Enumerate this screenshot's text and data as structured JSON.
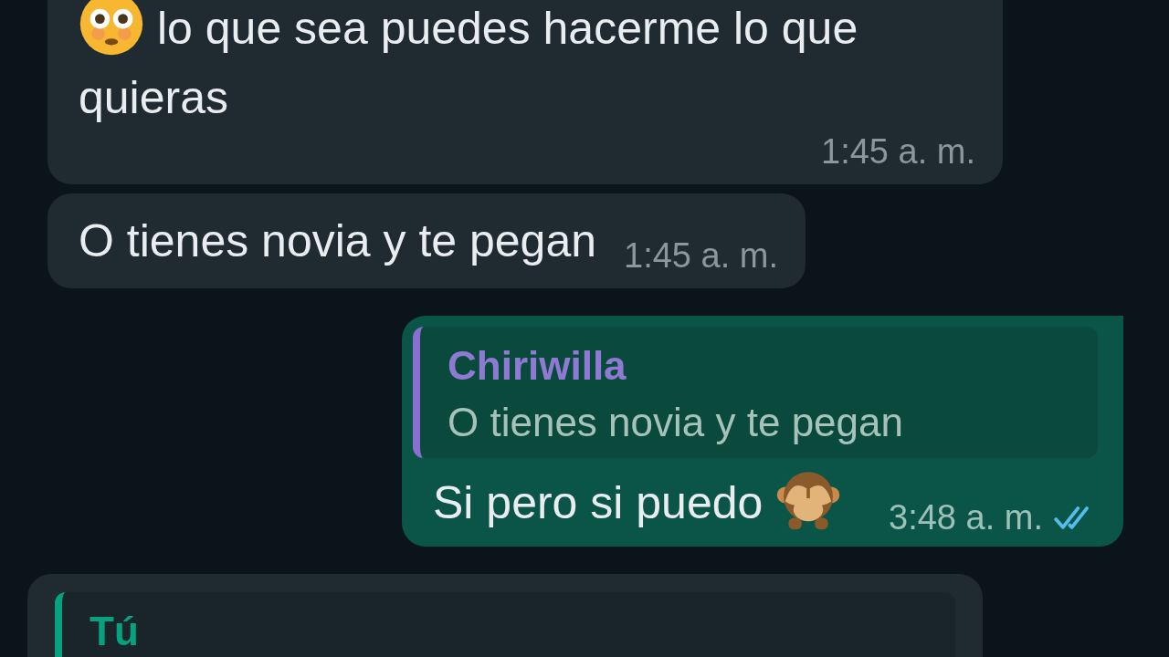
{
  "messages": [
    {
      "kind": "incoming",
      "leading_emoji": {
        "kind": "face"
      },
      "text": "lo que sea puedes hacerme lo que quieras",
      "time": "1:45 a. m."
    },
    {
      "kind": "incoming",
      "text": "O tienes novia y te pegan",
      "time": "1:45 a. m."
    },
    {
      "kind": "outgoing",
      "quote": {
        "author": "Chiriwilla",
        "text": "O tienes novia y te pegan"
      },
      "text": "Si pero si puedo",
      "trailing_emoji": {
        "kind": "monkey"
      },
      "time": "3:48 a. m.",
      "read": true
    },
    {
      "kind": "incoming",
      "quote": {
        "author": "Tú"
      }
    }
  ]
}
